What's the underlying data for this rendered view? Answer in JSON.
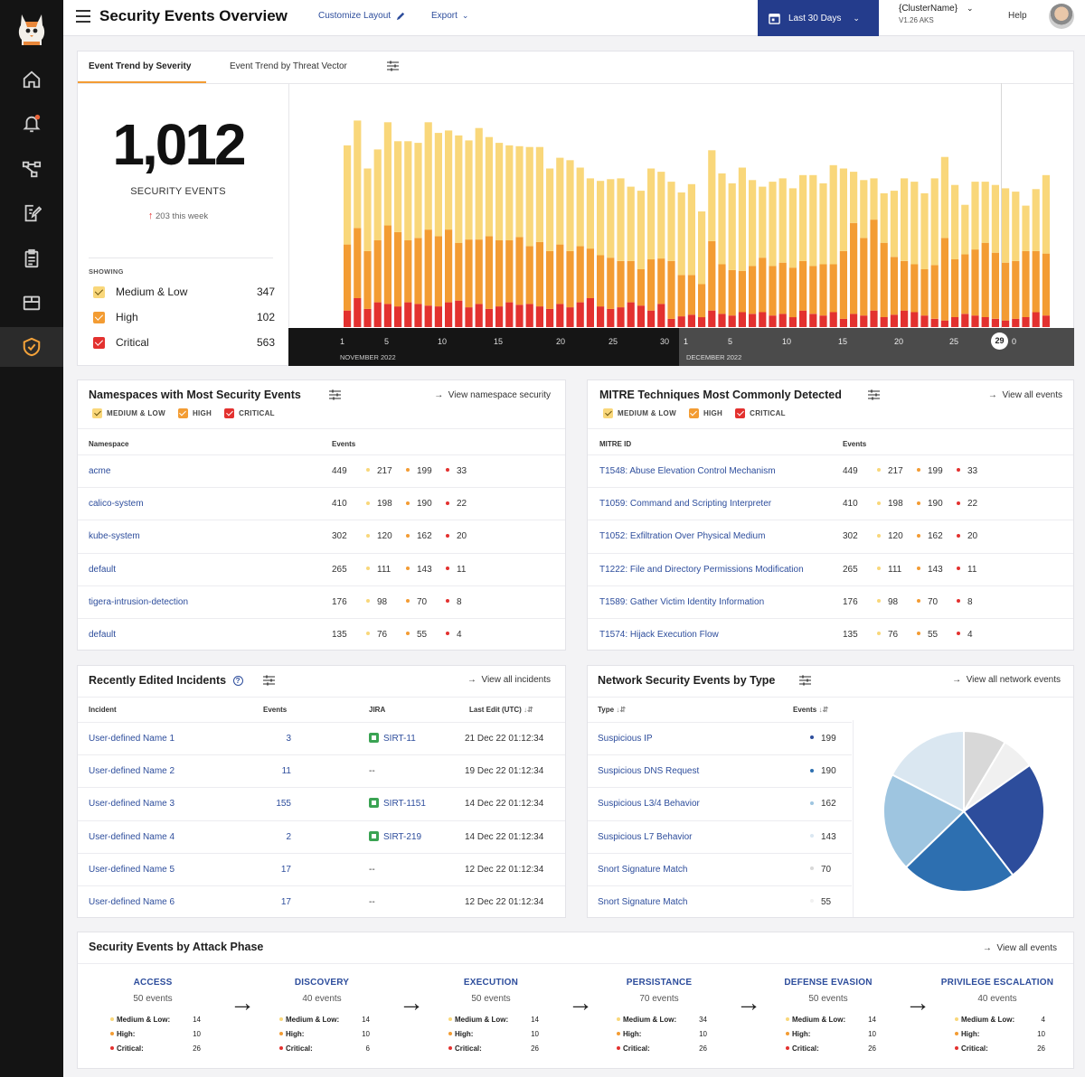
{
  "header": {
    "title": "Security Events Overview",
    "customize_label": "Customize Layout",
    "export_label": "Export",
    "date_range": "Last 30 Days",
    "cluster_name": "{ClusterName}",
    "cluster_version": "V1.26 AKS",
    "help_label": "Help"
  },
  "colors": {
    "medium_low": "#f9d77a",
    "high": "#f39c33",
    "critical": "#e3312f",
    "accent_blue": "#2d4d9c",
    "sidebar": "#141414"
  },
  "sidebar": {
    "icons": [
      "logo-cat-icon",
      "home-icon",
      "bell-icon",
      "network-graph-icon",
      "edit-document-icon",
      "clipboard-icon",
      "box-icon",
      "shield-check-icon"
    ]
  },
  "trend": {
    "tabs": [
      "Event Trend by Severity",
      "Event Trend by Threat Vector"
    ],
    "total": "1,012",
    "total_label": "SECURITY EVENTS",
    "weekly": "203 this week",
    "showing_label": "SHOWING",
    "legend": [
      {
        "label": "Medium & Low",
        "value": "347"
      },
      {
        "label": "High",
        "value": "102"
      },
      {
        "label": "Critical",
        "value": "563"
      }
    ],
    "axis_ticks_nov": [
      "1",
      "5",
      "10",
      "15",
      "20",
      "25",
      "30"
    ],
    "axis_ticks_dec": [
      "1",
      "5",
      "10",
      "15",
      "20",
      "25",
      "29",
      "0"
    ],
    "month_nov": "NOVEMBER 2022",
    "month_dec": "DECEMBER 2022"
  },
  "chart_data": {
    "type": "bar",
    "stacked": true,
    "series": [
      {
        "name": "Critical",
        "values": [
          20,
          35,
          22,
          30,
          28,
          25,
          30,
          28,
          26,
          25,
          30,
          32,
          24,
          28,
          22,
          25,
          30,
          27,
          28,
          25,
          22,
          28,
          24,
          30,
          35,
          25,
          22,
          24,
          30,
          26,
          20,
          28,
          10,
          13,
          15,
          12,
          20,
          16,
          14,
          18,
          16,
          18,
          14,
          16,
          12,
          20,
          16,
          14,
          18,
          10,
          16,
          14,
          20,
          12,
          15,
          20,
          18,
          14,
          10,
          8,
          12,
          16,
          14,
          12,
          10,
          8,
          10,
          12,
          18,
          14
        ]
      },
      {
        "name": "High",
        "values": [
          80,
          85,
          70,
          75,
          95,
          90,
          75,
          80,
          92,
          85,
          88,
          70,
          82,
          78,
          88,
          80,
          75,
          82,
          70,
          78,
          70,
          72,
          68,
          68,
          60,
          62,
          62,
          56,
          50,
          44,
          62,
          55,
          70,
          50,
          48,
          40,
          84,
          60,
          55,
          50,
          58,
          66,
          60,
          62,
          60,
          60,
          58,
          62,
          58,
          82,
          110,
          94,
          110,
          90,
          70,
          60,
          58,
          56,
          65,
          100,
          70,
          72,
          80,
          90,
          80,
          70,
          70,
          80,
          74,
          75
        ]
      },
      {
        "name": "Medium & Low",
        "values": [
          120,
          130,
          100,
          110,
          125,
          110,
          120,
          115,
          130,
          125,
          120,
          130,
          120,
          135,
          120,
          118,
          115,
          110,
          120,
          115,
          100,
          105,
          110,
          95,
          85,
          90,
          95,
          100,
          90,
          95,
          110,
          105,
          96,
          100,
          110,
          88,
          110,
          110,
          105,
          125,
          104,
          86,
          102,
          102,
          96,
          104,
          110,
          98,
          120,
          100,
          62,
          70,
          50,
          60,
          80,
          100,
          100,
          92,
          105,
          98,
          90,
          60,
          82,
          74,
          82,
          90,
          84,
          55,
          75,
          95
        ]
      }
    ],
    "xlabel": "",
    "ylabel": ""
  },
  "namespaces": {
    "title": "Namespaces with Most Security Events",
    "link": "View namespace security",
    "legend": [
      "MEDIUM & LOW",
      "HIGH",
      "CRITICAL"
    ],
    "col_name": "Namespace",
    "col_events": "Events",
    "rows": [
      {
        "name": "acme",
        "total": "449",
        "ml": "217",
        "hi": "199",
        "cr": "33"
      },
      {
        "name": "calico-system",
        "total": "410",
        "ml": "198",
        "hi": "190",
        "cr": "22"
      },
      {
        "name": "kube-system",
        "total": "302",
        "ml": "120",
        "hi": "162",
        "cr": "20"
      },
      {
        "name": "default",
        "total": "265",
        "ml": "111",
        "hi": "143",
        "cr": "11"
      },
      {
        "name": "tigera-intrusion-detection",
        "total": "176",
        "ml": "98",
        "hi": "70",
        "cr": "8"
      },
      {
        "name": "default",
        "total": "135",
        "ml": "76",
        "hi": "55",
        "cr": "4"
      }
    ]
  },
  "mitre": {
    "title": "MITRE Techniques Most Commonly Detected",
    "link": "View all events",
    "legend": [
      "MEDIUM & LOW",
      "HIGH",
      "CRITICAL"
    ],
    "col_name": "MITRE ID",
    "col_events": "Events",
    "rows": [
      {
        "name": "T1548: Abuse Elevation Control Mechanism",
        "total": "449",
        "ml": "217",
        "hi": "199",
        "cr": "33"
      },
      {
        "name": "T1059: Command and Scripting Interpreter",
        "total": "410",
        "ml": "198",
        "hi": "190",
        "cr": "22"
      },
      {
        "name": "T1052: Exfiltration Over Physical Medium",
        "total": "302",
        "ml": "120",
        "hi": "162",
        "cr": "20"
      },
      {
        "name": "T1222: File and Directory Permissions Modification",
        "total": "265",
        "ml": "111",
        "hi": "143",
        "cr": "11"
      },
      {
        "name": "T1589: Gather Victim Identity Information",
        "total": "176",
        "ml": "98",
        "hi": "70",
        "cr": "8"
      },
      {
        "name": "T1574: Hijack Execution Flow",
        "total": "135",
        "ml": "76",
        "hi": "55",
        "cr": "4"
      }
    ]
  },
  "incidents": {
    "title": "Recently Edited Incidents",
    "link": "View all incidents",
    "col_incident": "Incident",
    "col_events": "Events",
    "col_jira": "JIRA",
    "col_edit": "Last Edit (UTC)",
    "rows": [
      {
        "name": "User-defined Name 1",
        "events": "3",
        "jira": "SIRT-11",
        "edit": "21 Dec 22 01:12:34"
      },
      {
        "name": "User-defined Name 2",
        "events": "11",
        "jira": "--",
        "edit": "19 Dec 22 01:12:34"
      },
      {
        "name": "User-defined Name 3",
        "events": "155",
        "jira": "SIRT-1151",
        "edit": "14 Dec 22 01:12:34"
      },
      {
        "name": "User-defined Name 4",
        "events": "2",
        "jira": "SIRT-219",
        "edit": "14 Dec 22 01:12:34"
      },
      {
        "name": "User-defined Name 5",
        "events": "17",
        "jira": "--",
        "edit": "12 Dec 22 01:12:34"
      },
      {
        "name": "User-defined Name 6",
        "events": "17",
        "jira": "--",
        "edit": "12 Dec 22 01:12:34"
      }
    ]
  },
  "network": {
    "title": "Network Security Events by Type",
    "link": "View all network events",
    "col_type": "Type",
    "col_events": "Events",
    "rows": [
      {
        "name": "Suspicious IP",
        "events": "199",
        "color": "#2d4d9c"
      },
      {
        "name": "Suspicious DNS Request",
        "events": "190",
        "color": "#2d6fb0"
      },
      {
        "name": "Suspicious L3/4 Behavior",
        "events": "162",
        "color": "#9ec5e0"
      },
      {
        "name": "Suspicious L7 Behavior",
        "events": "143",
        "color": "#dae7f1"
      },
      {
        "name": "Snort Signature Match",
        "events": "70",
        "color": "#d8d8d8"
      },
      {
        "name": "Snort Signature Match",
        "events": "55",
        "color": "#f0f0f0"
      }
    ]
  },
  "phases": {
    "title": "Security Events by Attack Phase",
    "link": "View all events",
    "labels": {
      "ml": "Medium & Low:",
      "hi": "High:",
      "cr": "Critical:"
    },
    "items": [
      {
        "name": "ACCESS",
        "events": "50 events",
        "ml": "14",
        "hi": "10",
        "cr": "26"
      },
      {
        "name": "DISCOVERY",
        "events": "40 events",
        "ml": "14",
        "hi": "10",
        "cr": "6"
      },
      {
        "name": "EXECUTION",
        "events": "50 events",
        "ml": "14",
        "hi": "10",
        "cr": "26"
      },
      {
        "name": "PERSISTANCE",
        "events": "70 events",
        "ml": "34",
        "hi": "10",
        "cr": "26"
      },
      {
        "name": "DEFENSE EVASION",
        "events": "50 events",
        "ml": "14",
        "hi": "10",
        "cr": "26"
      },
      {
        "name": "PRIVILEGE ESCALATION",
        "events": "40 events",
        "ml": "4",
        "hi": "10",
        "cr": "26"
      }
    ]
  }
}
